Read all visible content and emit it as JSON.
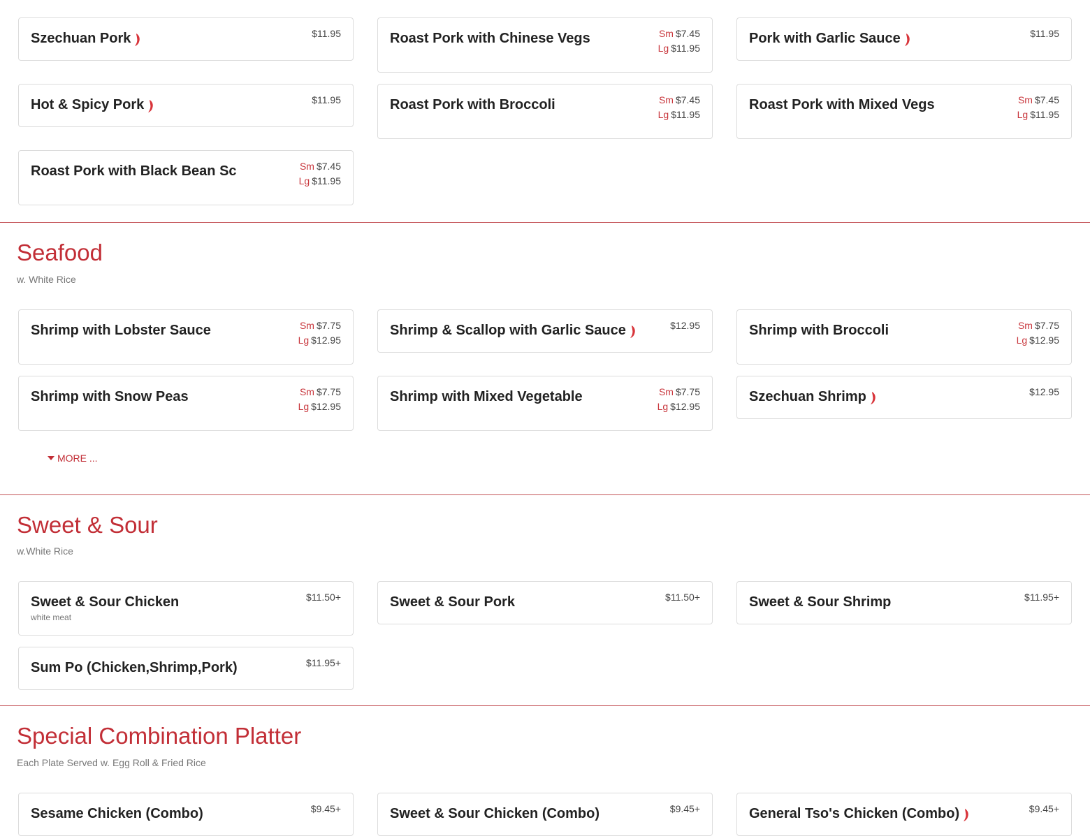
{
  "pork": {
    "items": [
      {
        "name": "Szechuan Pork",
        "spicy": true,
        "price": "$11.95"
      },
      {
        "name": "Roast Pork with Chinese Vegs",
        "sm": "$7.45",
        "lg": "$11.95"
      },
      {
        "name": "Pork with Garlic Sauce",
        "spicy": true,
        "price": "$11.95"
      },
      {
        "name": "Hot & Spicy Pork",
        "spicy": true,
        "price": "$11.95"
      },
      {
        "name": "Roast Pork with Broccoli",
        "sm": "$7.45",
        "lg": "$11.95"
      },
      {
        "name": "Roast Pork with Mixed Vegs",
        "sm": "$7.45",
        "lg": "$11.95"
      },
      {
        "name": "Roast Pork with Black Bean Sc",
        "sm": "$7.45",
        "lg": "$11.95"
      }
    ]
  },
  "labels": {
    "sm": "Sm",
    "lg": "Lg",
    "more": "MORE ..."
  },
  "icons": {
    "spicy": "chili-pepper-icon",
    "more": "caret-down-icon"
  },
  "colors": {
    "accent": "#c22e36",
    "chili": "#d8343a"
  },
  "seafood": {
    "title": "Seafood",
    "subtitle": "w. White Rice",
    "items": [
      {
        "name": "Shrimp with Lobster Sauce",
        "sm": "$7.75",
        "lg": "$12.95"
      },
      {
        "name": "Shrimp & Scallop with Garlic Sauce",
        "spicy": true,
        "price": "$12.95"
      },
      {
        "name": "Shrimp with Broccoli",
        "sm": "$7.75",
        "lg": "$12.95"
      },
      {
        "name": "Shrimp with Snow Peas",
        "sm": "$7.75",
        "lg": "$12.95"
      },
      {
        "name": "Shrimp with Mixed Vegetable",
        "sm": "$7.75",
        "lg": "$12.95"
      },
      {
        "name": "Szechuan Shrimp",
        "spicy": true,
        "price": "$12.95"
      }
    ]
  },
  "sweet_sour": {
    "title": "Sweet & Sour",
    "subtitle": "w.White Rice",
    "items": [
      {
        "name": "Sweet & Sour Chicken",
        "desc": "white meat",
        "price": "$11.50+"
      },
      {
        "name": "Sweet & Sour Pork",
        "price": "$11.50+"
      },
      {
        "name": "Sweet & Sour Shrimp",
        "price": "$11.95+"
      },
      {
        "name": "Sum Po (Chicken,Shrimp,Pork)",
        "price": "$11.95+"
      }
    ]
  },
  "combo": {
    "title": "Special Combination Platter",
    "subtitle": "Each Plate Served w. Egg Roll & Fried Rice",
    "items": [
      {
        "name": "Sesame Chicken (Combo)",
        "price": "$9.45+"
      },
      {
        "name": "Sweet & Sour Chicken (Combo)",
        "price": "$9.45+"
      },
      {
        "name": "General Tso's Chicken (Combo)",
        "spicy": true,
        "price": "$9.45+"
      }
    ]
  }
}
